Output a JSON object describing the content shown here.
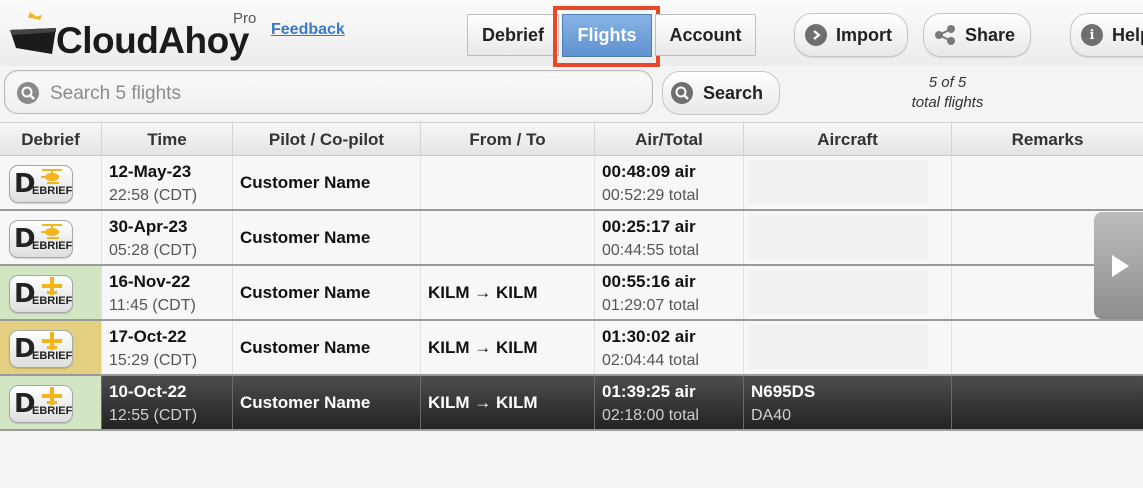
{
  "header": {
    "logo_text": "CloudAhoy",
    "logo_badge": "Pro",
    "feedback_link": "Feedback",
    "tabs": [
      {
        "label": "Debrief"
      },
      {
        "label": "Flights",
        "active": true
      },
      {
        "label": "Account"
      }
    ],
    "buttons": [
      {
        "label": "Import",
        "icon": "chevron-right-circle-icon"
      },
      {
        "label": "Share",
        "icon": "share-icon"
      },
      {
        "label": "Help",
        "icon": "info-icon"
      }
    ]
  },
  "search": {
    "placeholder": "Search 5 flights",
    "button_label": "Search",
    "count_line1": "5 of 5",
    "count_line2": "total flights"
  },
  "table": {
    "columns": [
      "Debrief",
      "Time",
      "Pilot / Co-pilot",
      "From / To",
      "Air/Total",
      "Aircraft",
      "Remarks"
    ],
    "debrief_button": {
      "d": "D",
      "rest": "EBRIEF"
    },
    "rows": [
      {
        "date": "12-May-23",
        "time": "22:58 (CDT)",
        "pilot": "Customer Name",
        "route": "",
        "air": "00:48:09 air",
        "total": "00:52:29 total",
        "aircraft": "",
        "aircraft_type": "",
        "remarks": "",
        "aircraft_icon": "helicopter-icon",
        "status_color": "#f7f7f7"
      },
      {
        "date": "30-Apr-23",
        "time": "05:28 (CDT)",
        "pilot": "Customer Name",
        "route": "",
        "air": "00:25:17 air",
        "total": "00:44:55 total",
        "aircraft": "",
        "aircraft_type": "",
        "remarks": "",
        "aircraft_icon": "helicopter-icon",
        "status_color": "#f7f7f7"
      },
      {
        "date": "16-Nov-22",
        "time": "11:45 (CDT)",
        "pilot": "Customer Name",
        "route": "KILM → KILM",
        "air": "00:55:16 air",
        "total": "01:29:07 total",
        "aircraft": "",
        "aircraft_type": "",
        "remarks": "",
        "aircraft_icon": "airplane-icon",
        "status_color": "#d3e6c4"
      },
      {
        "date": "17-Oct-22",
        "time": "15:29 (CDT)",
        "pilot": "Customer Name",
        "route": "KILM → KILM",
        "air": "01:30:02 air",
        "total": "02:04:44 total",
        "aircraft": "",
        "aircraft_type": "",
        "remarks": "",
        "aircraft_icon": "airplane-icon",
        "status_color": "#e2cf7f"
      },
      {
        "date": "10-Oct-22",
        "time": "12:55 (CDT)",
        "pilot": "Customer Name",
        "route": "KILM → KILM",
        "air": "01:39:25 air",
        "total": "02:18:00 total",
        "aircraft": "N695DS",
        "aircraft_type": "DA40",
        "remarks": "",
        "aircraft_icon": "airplane-icon",
        "status_color": "#d3e6c4",
        "selected": true
      }
    ]
  },
  "colors": {
    "accent_blue": "#5f92cf",
    "highlight_frame": "#e8472a",
    "aircraft_yellow": "#f2b51b"
  }
}
